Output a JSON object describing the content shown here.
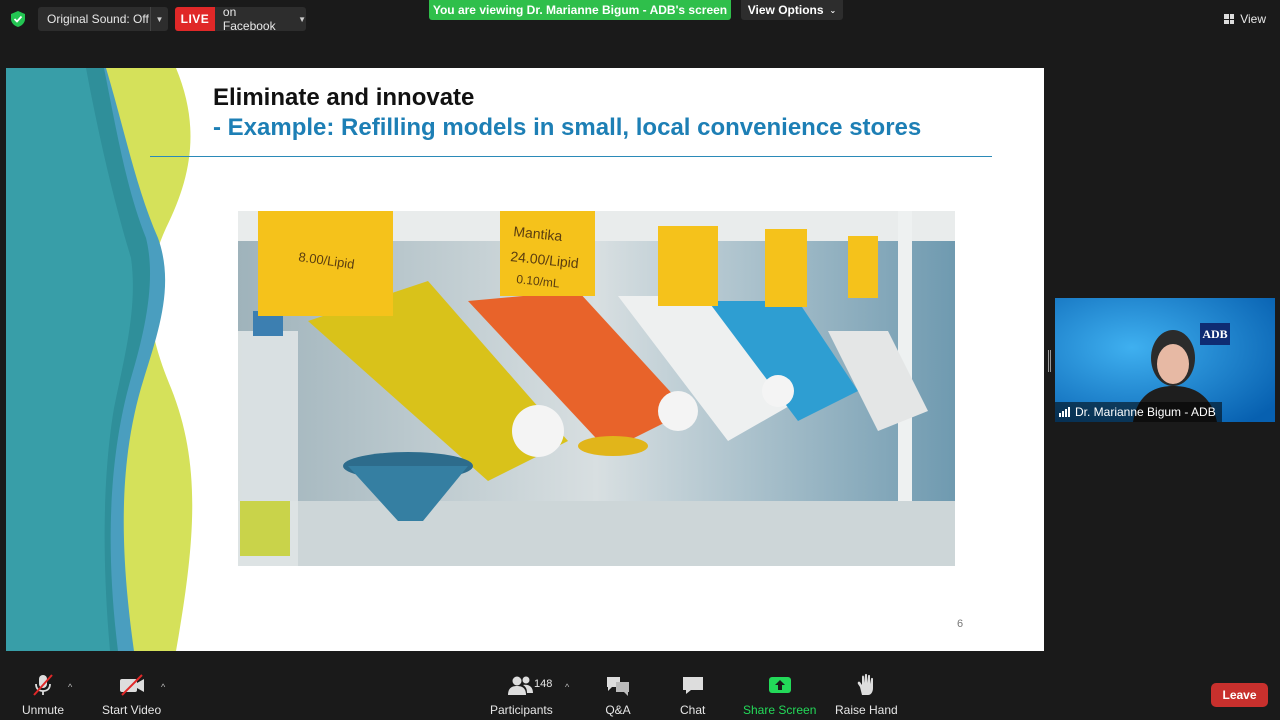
{
  "top_bar": {
    "original_sound_label": "Original Sound: Off",
    "live_badge": "LIVE",
    "live_destination": "on Facebook",
    "viewing_banner": "You are viewing Dr. Marianne Bigum - ADB's screen",
    "view_options_label": "View Options",
    "view_label": "View"
  },
  "slide": {
    "title": "Eliminate and innovate",
    "subtitle": "- Example: Refilling models in small, local convenience stores",
    "page_number": "6",
    "photo_labels": [
      "8.00/Lipid",
      "Mantika",
      "24.00/Lipid",
      "0.10/mL"
    ]
  },
  "video": {
    "participant_name": "Dr. Marianne Bigum - ADB",
    "logo_text": "ADB"
  },
  "toolbar": {
    "unmute_label": "Unmute",
    "start_video_label": "Start Video",
    "participants_label": "Participants",
    "participants_count": "148",
    "qa_label": "Q&A",
    "chat_label": "Chat",
    "share_screen_label": "Share Screen",
    "raise_hand_label": "Raise Hand",
    "leave_label": "Leave"
  },
  "colors": {
    "live_red": "#e02828",
    "banner_green": "#2fbf4b",
    "share_green": "#23d959",
    "leave_red": "#c8302d",
    "slide_title_blue": "#1d7fb5"
  }
}
